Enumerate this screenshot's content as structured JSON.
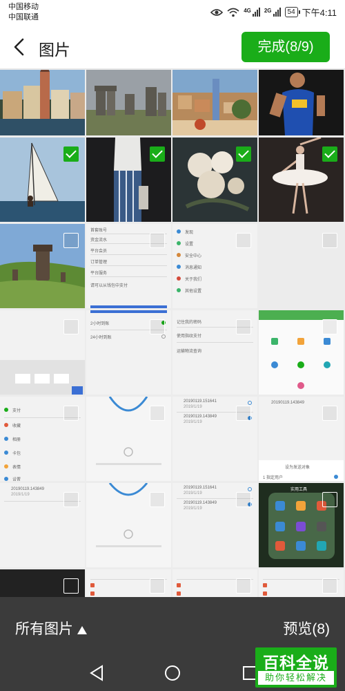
{
  "status_bar": {
    "carrier_1": "中国移动",
    "carrier_2": "中国联通",
    "net_1": "4G",
    "net_2": "2G",
    "battery": "54",
    "time": "下午4:11"
  },
  "header": {
    "title": "图片",
    "done_label": "完成(8/9)",
    "accent": "#1aad19"
  },
  "grid": {
    "thumb_texts": {
      "r3c2": [
        "首套账号",
        "资金流水",
        "平台会员",
        "订单管理",
        "平台服务",
        "请可以从钱包中支付"
      ],
      "r3c3": [
        "发现",
        "设置",
        "安全中心",
        "消息通知",
        "关于我们",
        "其他设置"
      ],
      "r4c2": [
        "2小时到账",
        "24小时到账"
      ],
      "r4c3": [
        "记住我的密码",
        "使用指纹支付",
        "运输物流查询"
      ],
      "r5c1": [
        "支付",
        "收藏",
        "相册",
        "卡包",
        "表情",
        "设置"
      ],
      "r5c3": [
        "20190119.151641",
        "2019/1/19",
        "20190119.143849",
        "2019/1/19"
      ],
      "r5c4": [
        "20190119.143849",
        "设为发送对象",
        "1 指定用户"
      ],
      "r6c4": [
        "实用工具"
      ]
    }
  },
  "bottom_bar": {
    "all_pictures": "所有图片",
    "preview": "预览(8)"
  },
  "watermark": {
    "main": "百科全说",
    "sub": "助你轻松解决"
  }
}
